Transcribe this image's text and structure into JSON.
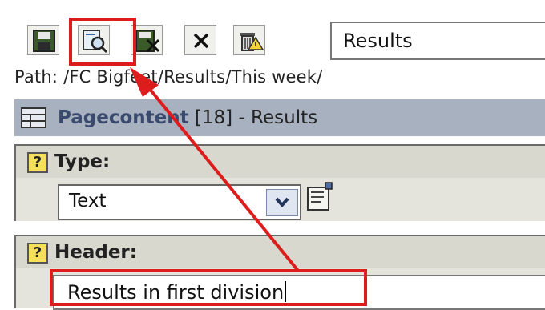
{
  "toolbar": {
    "buttons": [
      {
        "name": "save-button",
        "icon": "save-disk-icon"
      },
      {
        "name": "save-and-view-button",
        "icon": "view-page-icon"
      },
      {
        "name": "save-and-close-button",
        "icon": "save-close-icon"
      },
      {
        "name": "close-button",
        "icon": "close-x-icon"
      },
      {
        "name": "delete-button",
        "icon": "trash-icon"
      }
    ]
  },
  "title_field": {
    "value": "Results"
  },
  "path": {
    "text": "Path: /FC Bigfeet/Results/This week/"
  },
  "section": {
    "icon": "page-content-icon",
    "title_bold": "Pagecontent",
    "title_rest": " [18] - Results"
  },
  "type_field": {
    "label": "Type:",
    "help_glyph": "?",
    "selected": "Text"
  },
  "header_field": {
    "label": "Header:",
    "help_glyph": "?",
    "value": "Results in first division"
  },
  "colors": {
    "highlight": "#dd1c1c",
    "section_bar": "#a8b1bf",
    "field_bg": "#e4e4dc"
  }
}
